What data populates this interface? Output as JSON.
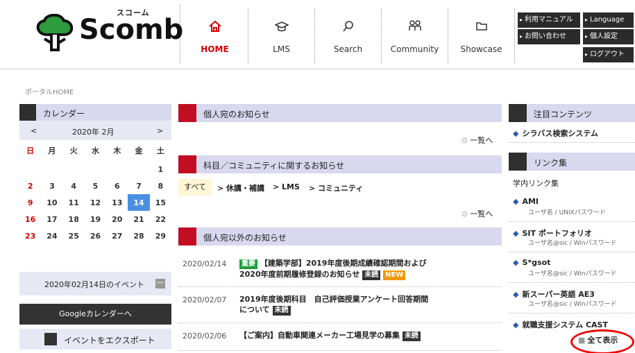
{
  "logo": {
    "kana": "スコーム",
    "word": "Scomb"
  },
  "nav": [
    {
      "label": "HOME",
      "icon": "home-icon"
    },
    {
      "label": "LMS",
      "icon": "graduation-cap-icon"
    },
    {
      "label": "Search",
      "icon": "search-icon"
    },
    {
      "label": "Community",
      "icon": "people-icon"
    },
    {
      "label": "Showcase",
      "icon": "folder-icon"
    }
  ],
  "util": {
    "manual": "利用マニュアル",
    "language": "Language",
    "contact": "お問い合わせ",
    "settings": "個人設定",
    "logout": "ログアウト"
  },
  "breadcrumb": "ポータルHOME",
  "calendar": {
    "title": "カレンダー",
    "prev": "<",
    "month": "2020年 2月",
    "next": ">",
    "weekdays": [
      "日",
      "月",
      "火",
      "水",
      "木",
      "金",
      "土"
    ],
    "weeks": [
      [
        "",
        "",
        "",
        "",
        "",
        "",
        "1"
      ],
      [
        "2",
        "3",
        "4",
        "5",
        "6",
        "7",
        "8"
      ],
      [
        "9",
        "10",
        "11",
        "12",
        "13",
        "14",
        "15"
      ],
      [
        "16",
        "17",
        "18",
        "19",
        "20",
        "21",
        "22"
      ],
      [
        "23",
        "24",
        "25",
        "26",
        "27",
        "28",
        "29"
      ]
    ],
    "today": "14",
    "events_title": "2020年02月14日のイベント",
    "minus": "－",
    "google_button": "Googleカレンダーへ",
    "export_button": "イベントをエクスポート"
  },
  "personal_notices": {
    "title": "個人宛のお知らせ",
    "more": "一覧へ"
  },
  "course_notices": {
    "title": "科目／コミュニティに関するお知らせ",
    "more": "一覧へ",
    "filters": [
      "すべて",
      "> 休講・補講",
      "> LMS",
      "> コミュニティ"
    ]
  },
  "other_notices": {
    "title": "個人宛以外のお知らせ",
    "items": [
      {
        "date": "2020/02/14",
        "tag_important": "重要",
        "line1": "【建築学部】2019年度後期成績確認期間および",
        "line2": "2020年度前期履修登録のお知らせ",
        "tag_unread": "未読",
        "tag_new": "NEW"
      },
      {
        "date": "2020/02/07",
        "line1": "2019年度後期科目　自己評価授業アンケート回答期間",
        "line2": "について",
        "tag_unread": "未読"
      },
      {
        "date": "2020/02/06",
        "line1": "【ご案内】自動車関連メーカー工場見学の募集",
        "tag_unread": "未読"
      }
    ]
  },
  "featured": {
    "title": "注目コンテンツ",
    "items": [
      {
        "label": "シラバス検索システム"
      }
    ]
  },
  "links": {
    "title": "リンク集",
    "section": "学内リンク集",
    "items": [
      {
        "label": "AMI",
        "sub": "ユーザ名 / UNIXパスワード"
      },
      {
        "label": "SIT ポートフォリオ",
        "sub": "ユーザ名@sic / Winパスワード"
      },
      {
        "label": "S*gsot",
        "sub": "ユーザ名@sic / Winパスワード"
      },
      {
        "label": "新スーパー英語 AE3",
        "sub": "ユーザ名@sic / Winパスワード"
      },
      {
        "label": "就職支援システム CAST",
        "sub": ""
      }
    ],
    "show_all": "全て表示"
  },
  "colors": {
    "accent_red": "#d40000",
    "header_bar": "#d8d8ee",
    "today": "#4a90e2"
  }
}
